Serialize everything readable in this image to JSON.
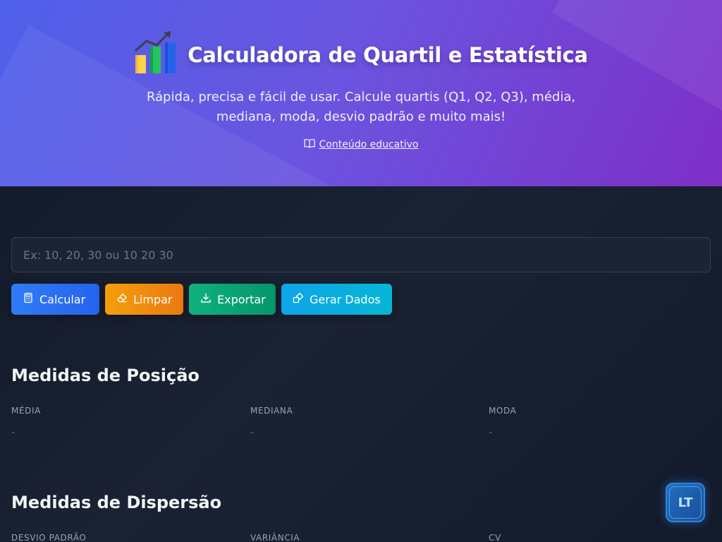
{
  "header": {
    "title": "Calculadora de Quartil e Estatística",
    "subtitle": "Rápida, precisa e fácil de usar. Calcule quartis (Q1, Q2, Q3), média, mediana, moda, desvio padrão e muito mais!",
    "edu_link": "Conteúdo educativo",
    "icon": "bar-chart-trend-icon"
  },
  "input": {
    "placeholder": "Ex: 10, 20, 30 ou 10 20 30",
    "value": ""
  },
  "buttons": {
    "calc": "Calcular",
    "clear": "Limpar",
    "export": "Exportar",
    "generate": "Gerar Dados"
  },
  "position_section": {
    "title": "Medidas de Posição",
    "items": [
      {
        "label": "MÉDIA",
        "value": "-"
      },
      {
        "label": "MEDIANA",
        "value": "-"
      },
      {
        "label": "MODA",
        "value": "-"
      }
    ]
  },
  "dispersion_section": {
    "title": "Medidas de Dispersão",
    "items": [
      {
        "label": "DESVIO PADRÃO"
      },
      {
        "label": "VARIÂNCIA"
      },
      {
        "label": "CV"
      }
    ]
  },
  "badge": {
    "text": "LT"
  },
  "colors": {
    "calc": "#2563eb",
    "clear": "#f59e0b",
    "export": "#059669",
    "generate": "#0ea5e9"
  }
}
